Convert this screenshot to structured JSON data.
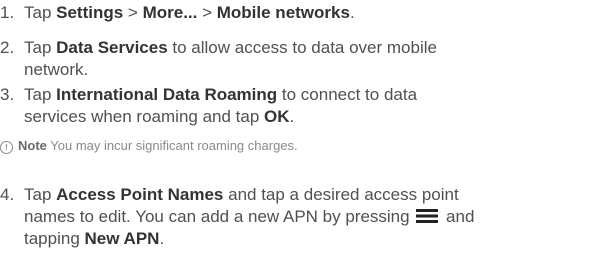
{
  "steps": [
    {
      "number": "1.",
      "t1": "Tap ",
      "b1": "Settings",
      "t2": " > ",
      "b2": "More...",
      "t3": " > ",
      "b3": "Mobile networks",
      "t4": "."
    },
    {
      "number": "2.",
      "t1": "Tap ",
      "b1": "Data Services",
      "t2": " to allow access to data over mobile",
      "line2": "network."
    },
    {
      "number": "3.",
      "t1": "Tap ",
      "b1": "International Data Roaming",
      "t2": " to connect to data",
      "l2a": "services when roaming and tap ",
      "l2b": "OK",
      "l2c": "."
    },
    {
      "number": "4.",
      "t1": "Tap ",
      "b1": "Access Point Names",
      "t2": " and tap a desired access point",
      "l2a": "names to edit. You can add a new APN by pressing ",
      "l2icon": "menu-icon",
      "l2b": " and",
      "l3a": "tapping ",
      "l3b": "New APN",
      "l3c": "."
    }
  ],
  "note": {
    "icon": "info-icon",
    "icon_glyph": "!",
    "label": "Note",
    "text": " You may incur significant roaming charges."
  }
}
